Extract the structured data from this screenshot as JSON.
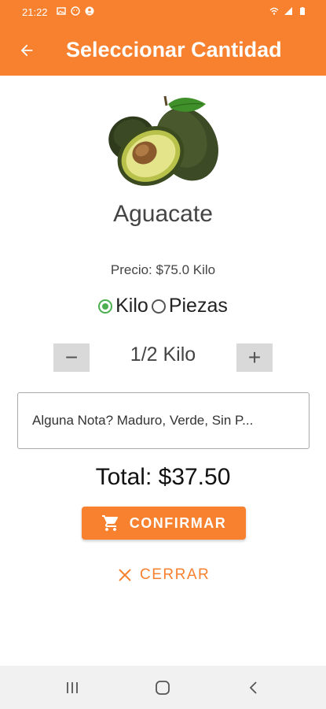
{
  "status_bar": {
    "time": "21:22"
  },
  "header": {
    "title": "Seleccionar Cantidad"
  },
  "product": {
    "name": "Aguacate",
    "price_text": "Precio: $75.0 Kilo"
  },
  "unit_options": [
    {
      "label": "Kilo",
      "selected": true
    },
    {
      "label": "Piezas",
      "selected": false
    }
  ],
  "quantity": {
    "value": "1/2 Kilo",
    "minus": "−",
    "plus": "+"
  },
  "note": {
    "placeholder": "Alguna Nota? Maduro, Verde, Sin P..."
  },
  "total": {
    "text": "Total:  $37.50"
  },
  "actions": {
    "confirm_label": "CONFIRMAR",
    "close_label": "CERRAR"
  },
  "colors": {
    "accent": "#f7812f",
    "radio_selected": "#4caf50",
    "stepper_bg": "#d9d9d9"
  },
  "icons": {
    "back": "arrow-left-icon",
    "cart": "shopping-cart-icon",
    "close": "close-icon"
  }
}
